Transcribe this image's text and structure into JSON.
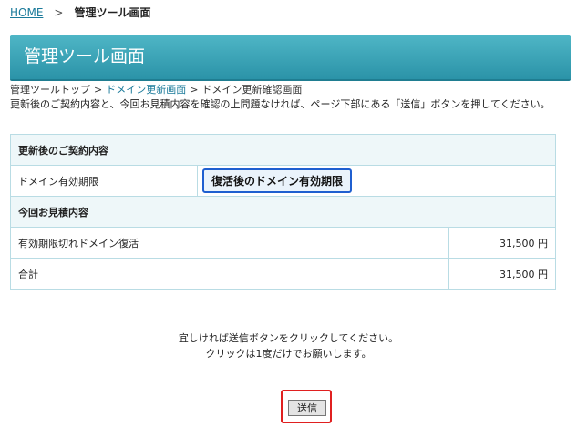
{
  "top_breadcrumb": {
    "home": "HOME",
    "separator": ">",
    "current": "管理ツール画面"
  },
  "banner": {
    "title": "管理ツール画面"
  },
  "breadcrumb": {
    "items": [
      "管理ツールトップ",
      "ドメイン更新画面",
      "ドメイン更新確認画面"
    ],
    "separator": ">"
  },
  "instruction": "更新後のご契約内容と、今回お見積内容を確認の上問題なければ、ページ下部にある「送信」ボタンを押してください。",
  "contract": {
    "heading": "更新後のご契約内容",
    "label": "ドメイン有効期限",
    "value": "復活後のドメイン有効期限"
  },
  "estimate": {
    "heading": "今回お見積内容",
    "rows": [
      {
        "label": "有効期限切れドメイン復活",
        "amount": "31,500 円"
      },
      {
        "label": "合計",
        "amount": "31,500 円"
      }
    ]
  },
  "message": {
    "line1": "宜しければ送信ボタンをクリックしてください。",
    "line2": "クリックは1度だけでお願いします。"
  },
  "submit_label": "送信",
  "colors": {
    "banner": "#3aa3b6",
    "highlight_border": "#1f5fd0",
    "submit_highlight": "#e02020"
  }
}
